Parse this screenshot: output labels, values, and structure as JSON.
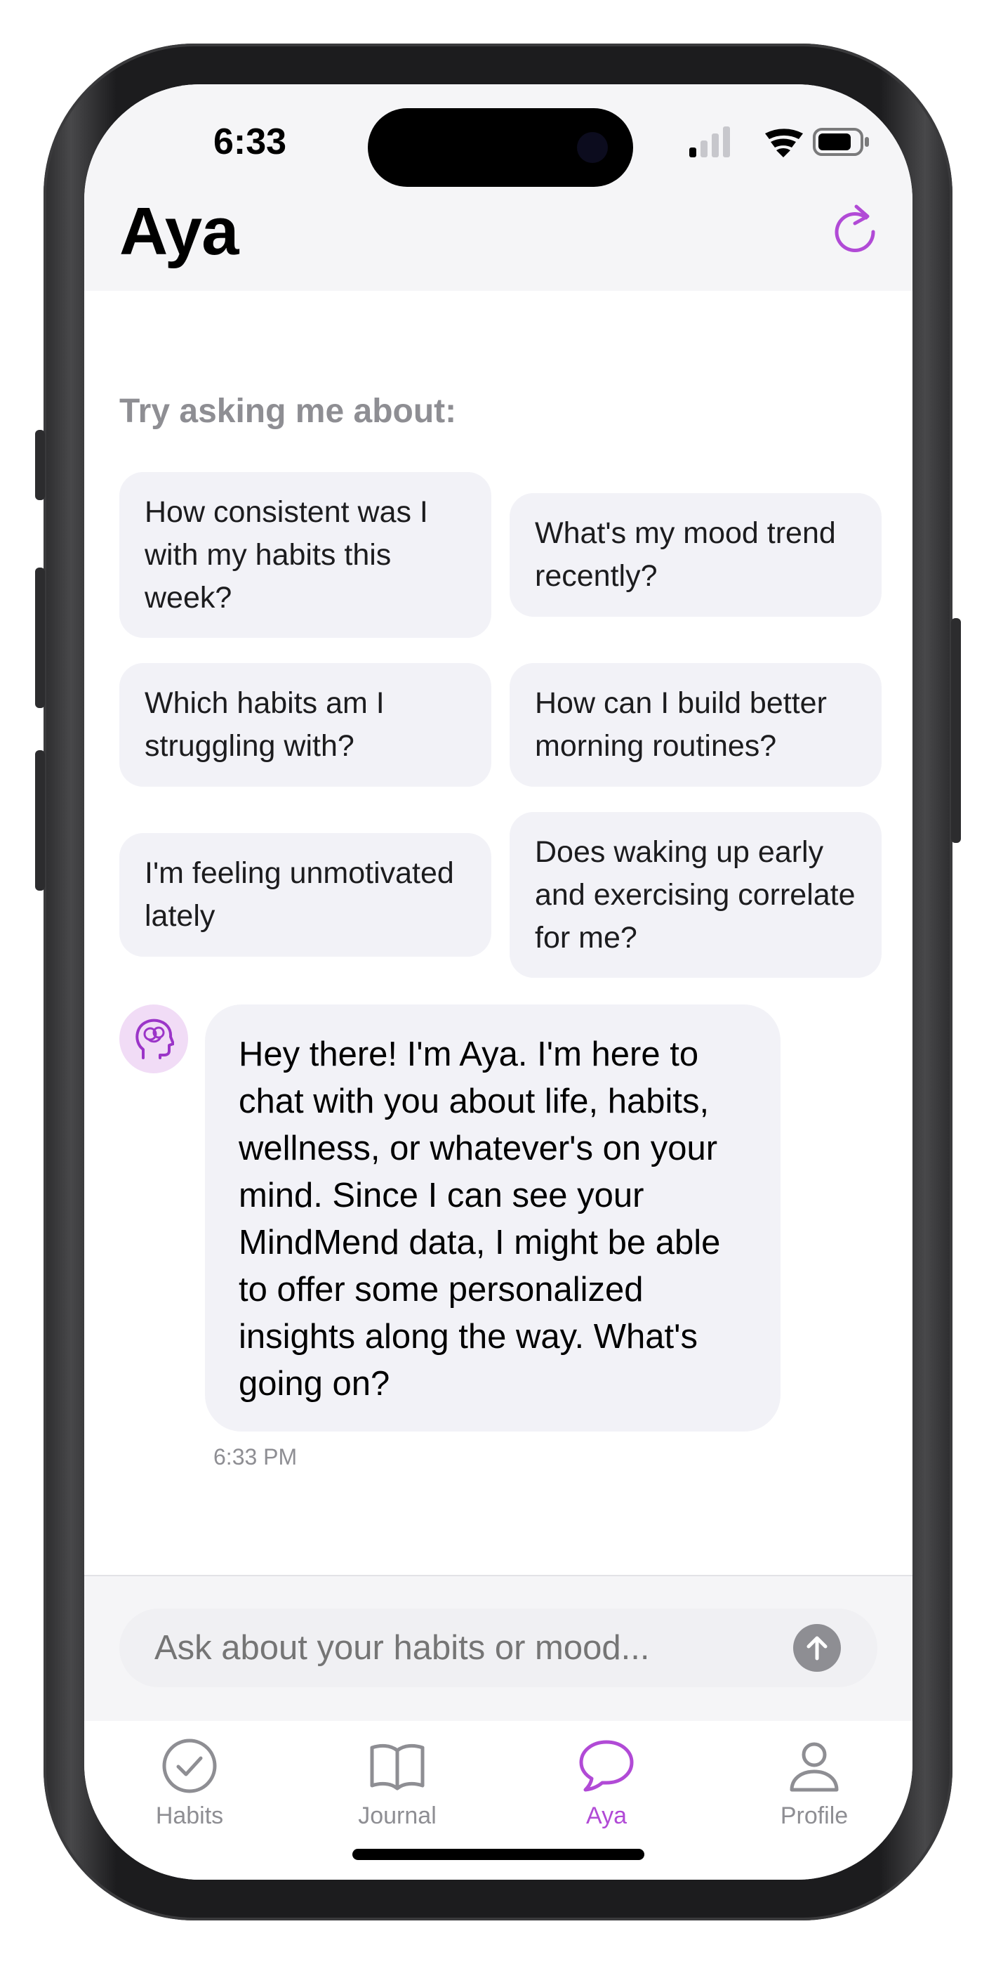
{
  "status_bar": {
    "time": "6:33"
  },
  "header": {
    "title": "Aya"
  },
  "suggestions": {
    "heading": "Try asking me about:",
    "items": [
      "How consistent was I with my habits this week?",
      "What's my mood trend recently?",
      "Which habits am I struggling with?",
      "How can I build better morning routines?",
      "I'm feeling unmotivated lately",
      "Does waking up early and exercising correlate for me?"
    ]
  },
  "chat": {
    "message": "Hey there! I'm Aya. I'm here to chat with you about life, habits, wellness, or whatever's on your mind. Since I can see your MindMend data, I might be able to offer some personalized insights along the way. What's going on?",
    "timestamp": "6:33 PM"
  },
  "input": {
    "placeholder": "Ask about your habits or mood..."
  },
  "tabs": [
    {
      "label": "Habits",
      "icon": "checkmark-circle-icon"
    },
    {
      "label": "Journal",
      "icon": "book-icon"
    },
    {
      "label": "Aya",
      "icon": "chat-bubble-icon"
    },
    {
      "label": "Profile",
      "icon": "person-icon"
    }
  ],
  "colors": {
    "accent": "#b14ad6",
    "chip_bg": "#f2f2f7",
    "secondary_text": "#8e8e93"
  }
}
